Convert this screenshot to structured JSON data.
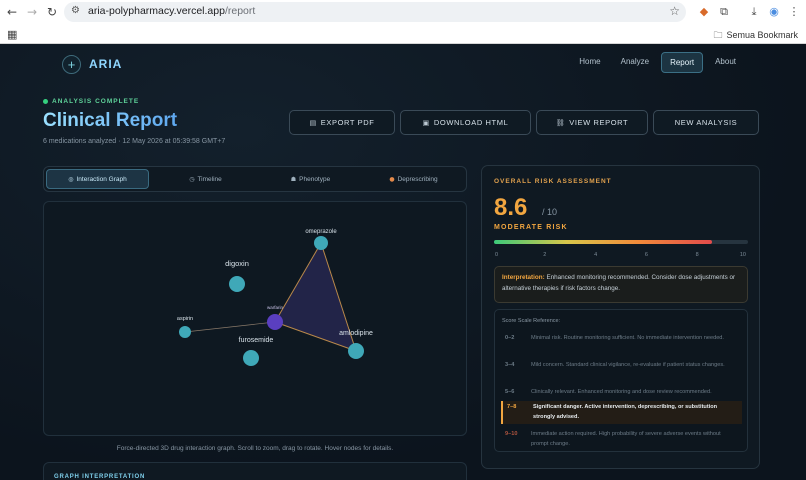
{
  "browser": {
    "url_host": "aria-polypharmacy.vercel.app",
    "url_path": "/report",
    "bookmarks_label": "Semua Bookmark"
  },
  "app": {
    "brand": "ARIA",
    "nav": [
      "Home",
      "Analyze",
      "Report",
      "About"
    ],
    "active_nav": "Report"
  },
  "header": {
    "status": "ANALYSIS COMPLETE",
    "title": "Clinical Report",
    "subtitle": "6 medications analyzed · 12 May 2026 at 05:39:58 GMT+7",
    "actions": [
      "EXPORT PDF",
      "DOWNLOAD HTML",
      "VIEW REPORT",
      "NEW ANALYSIS"
    ]
  },
  "tabs": [
    "Interaction Graph",
    "Timeline",
    "Phenotype",
    "Deprescribing"
  ],
  "graph": {
    "caption": "Force-directed 3D drug interaction graph. Scroll to zoom, drag to rotate. Hover nodes for details.",
    "nodes": [
      {
        "label": "omeprazole",
        "kind": "drug"
      },
      {
        "label": "digoxin",
        "kind": "drug"
      },
      {
        "label": "aspirin",
        "kind": "drug"
      },
      {
        "label": "warfarin",
        "kind": "anchor"
      },
      {
        "label": "amlodipine",
        "kind": "drug"
      },
      {
        "label": "furosemide",
        "kind": "drug"
      }
    ],
    "interpretation_label": "GRAPH INTERPRETATION"
  },
  "risk": {
    "heading": "OVERALL RISK ASSESSMENT",
    "score": 8.6,
    "score_text": "8.6",
    "max_text": "/ 10",
    "level": "MODERATE RISK",
    "ticks": [
      "0",
      "2",
      "4",
      "6",
      "8",
      "10"
    ],
    "interpretation_label": "Interpretation:",
    "interpretation_text": "Enhanced monitoring recommended. Consider dose adjustments or alternative therapies if risk factors change.",
    "scale_title": "Score Scale Reference:",
    "scale": [
      {
        "range": "0–2",
        "text": "Minimal risk. Routine monitoring sufficient. No immediate intervention needed."
      },
      {
        "range": "3–4",
        "text": "Mild concern. Standard clinical vigilance, re-evaluate if patient status changes."
      },
      {
        "range": "5–6",
        "text": "Clinically relevant. Enhanced monitoring and dose review recommended."
      },
      {
        "range": "7–8",
        "text": "Significant danger. Active intervention, deprescribing, or substitution strongly advised."
      },
      {
        "range": "9–10",
        "text": "Immediate action required. High probability of severe adverse events without prompt change."
      }
    ],
    "active_scale_index": 3
  },
  "colors": {
    "accent": "#f2a640",
    "node": "#3fa8b8",
    "anchor": "#5a3fc0",
    "edge": "#b9884a"
  }
}
